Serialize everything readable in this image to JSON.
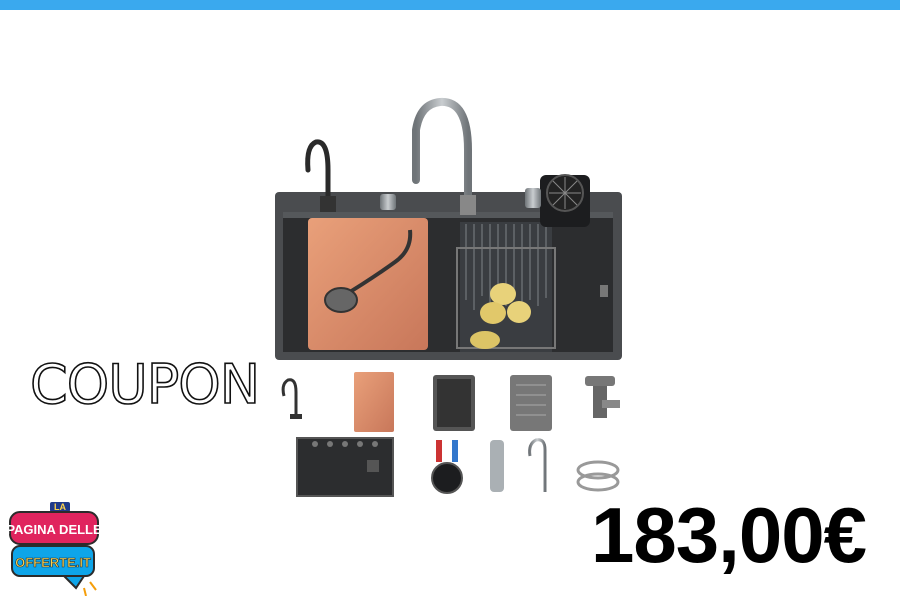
{
  "banner": {
    "accent_color": "#3aa9ee"
  },
  "product": {
    "image": "kitchen-sink-with-accessories"
  },
  "coupon_text": "COUPON",
  "price": "183,00€",
  "logo": {
    "line1": "LA",
    "line2": "PAGINA DELLE",
    "line3": "OFFERTE.IT"
  }
}
